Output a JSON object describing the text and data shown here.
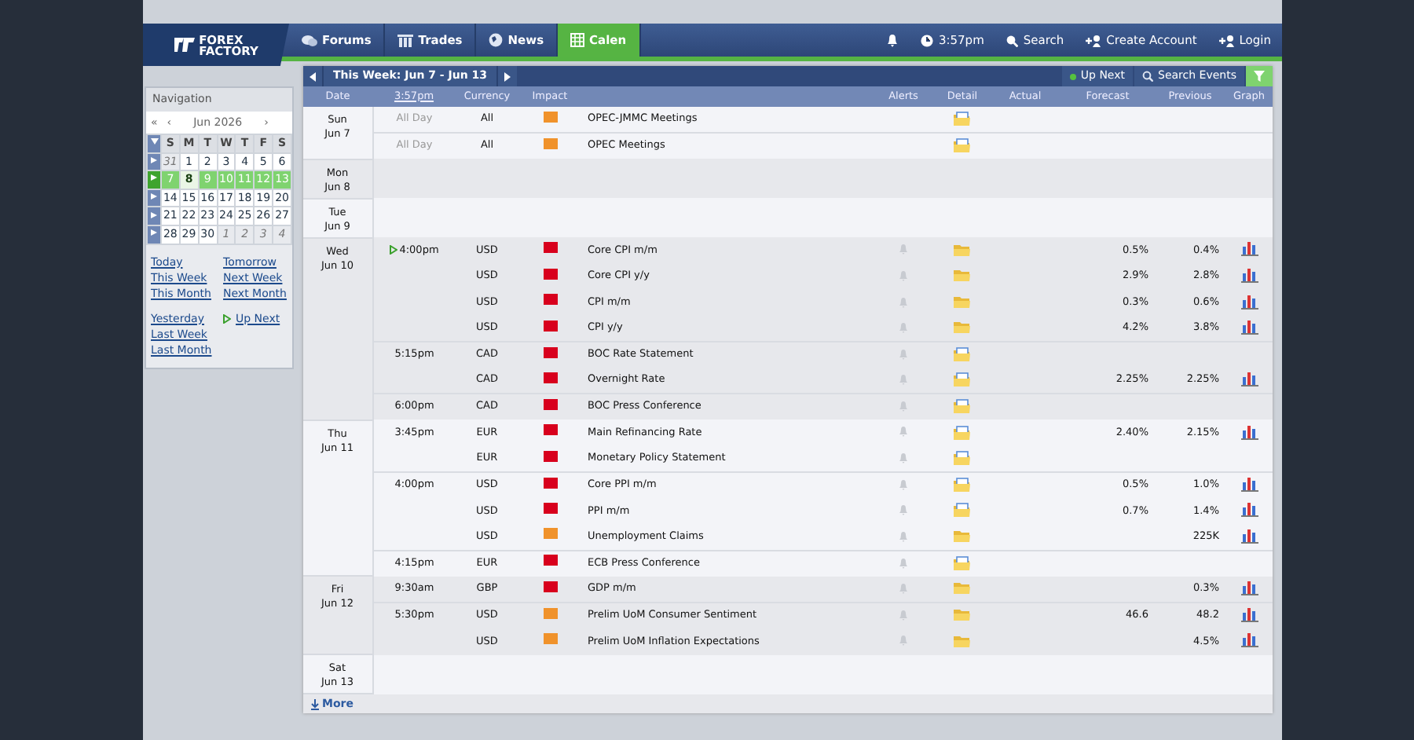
{
  "header": {
    "logo": [
      "FOREX",
      "FACTORY"
    ],
    "tabs": [
      {
        "kind": "chat",
        "label": "Forums",
        "selected": false
      },
      {
        "kind": "trades",
        "label": "Trades",
        "selected": false
      },
      {
        "kind": "globe",
        "label": "News",
        "selected": false
      },
      {
        "kind": "calendar",
        "label": "Calen",
        "selected": true
      }
    ],
    "time": "3:57pm",
    "links": [
      {
        "kind": "search",
        "label": "Search"
      },
      {
        "kind": "account",
        "label": "Create Account"
      },
      {
        "kind": "account",
        "label": "Login"
      }
    ]
  },
  "sidebar": {
    "title": "Navigation",
    "nav_left": [
      "«",
      "‹"
    ],
    "month": "Jun 2026",
    "nav_right": "›",
    "weekdays": [
      "S",
      "M",
      "T",
      "W",
      "T",
      "F",
      "S"
    ],
    "weeks": [
      {
        "selected": false,
        "days": [
          {
            "d": "31",
            "other": true,
            "today": false
          },
          {
            "d": "1",
            "other": false,
            "today": false
          },
          {
            "d": "2",
            "other": false,
            "today": false
          },
          {
            "d": "3",
            "other": false,
            "today": false
          },
          {
            "d": "4",
            "other": false,
            "today": false
          },
          {
            "d": "5",
            "other": false,
            "today": false
          },
          {
            "d": "6",
            "other": false,
            "today": false
          }
        ]
      },
      {
        "selected": true,
        "days": [
          {
            "d": "7",
            "other": false,
            "today": false
          },
          {
            "d": "8",
            "other": false,
            "today": true
          },
          {
            "d": "9",
            "other": false,
            "today": false
          },
          {
            "d": "10",
            "other": false,
            "today": false
          },
          {
            "d": "11",
            "other": false,
            "today": false
          },
          {
            "d": "12",
            "other": false,
            "today": false
          },
          {
            "d": "13",
            "other": false,
            "today": false
          }
        ]
      },
      {
        "selected": false,
        "days": [
          {
            "d": "14",
            "other": false,
            "today": false
          },
          {
            "d": "15",
            "other": false,
            "today": false
          },
          {
            "d": "16",
            "other": false,
            "today": false
          },
          {
            "d": "17",
            "other": false,
            "today": false
          },
          {
            "d": "18",
            "other": false,
            "today": false
          },
          {
            "d": "19",
            "other": false,
            "today": false
          },
          {
            "d": "20",
            "other": false,
            "today": false
          }
        ]
      },
      {
        "selected": false,
        "days": [
          {
            "d": "21",
            "other": false,
            "today": false
          },
          {
            "d": "22",
            "other": false,
            "today": false
          },
          {
            "d": "23",
            "other": false,
            "today": false
          },
          {
            "d": "24",
            "other": false,
            "today": false
          },
          {
            "d": "25",
            "other": false,
            "today": false
          },
          {
            "d": "26",
            "other": false,
            "today": false
          },
          {
            "d": "27",
            "other": false,
            "today": false
          }
        ]
      },
      {
        "selected": false,
        "days": [
          {
            "d": "28",
            "other": false,
            "today": false
          },
          {
            "d": "29",
            "other": false,
            "today": false
          },
          {
            "d": "30",
            "other": false,
            "today": false
          },
          {
            "d": "1",
            "other": true,
            "today": false
          },
          {
            "d": "2",
            "other": true,
            "today": false
          },
          {
            "d": "3",
            "other": true,
            "today": false
          },
          {
            "d": "4",
            "other": true,
            "today": false
          }
        ]
      }
    ],
    "link_groups": [
      {
        "left": [
          {
            "label": "Today"
          },
          {
            "label": "This Week"
          },
          {
            "label": "This Month"
          }
        ],
        "right": [
          {
            "label": "Tomorrow"
          },
          {
            "label": "Next Week"
          },
          {
            "label": "Next Month"
          }
        ]
      },
      {
        "left": [
          {
            "label": "Yesterday"
          },
          {
            "label": "Last Week"
          },
          {
            "label": "Last Month"
          }
        ],
        "right": [
          {
            "label": "Up Next",
            "up_next": true
          }
        ]
      }
    ]
  },
  "calendar": {
    "week_label": "This Week: Jun 7 - Jun 13",
    "up_next": "Up Next",
    "search": "Search Events",
    "columns": [
      "Date",
      "3:57pm",
      "Currency",
      "Impact",
      null,
      "Alerts",
      "Detail",
      "Actual",
      "Forecast",
      "Previous",
      "Graph"
    ],
    "days": [
      {
        "day": "Sun",
        "date": "Jun 7",
        "events": [
          {
            "time": "All Day",
            "all_day": true,
            "currency": "All",
            "color": "#f0922b",
            "title": "OPEC-JMMC Meetings",
            "alert": false,
            "has_note": true,
            "graph": false
          },
          {
            "time": "All Day",
            "all_day": true,
            "currency": "All",
            "color": "#f0922b",
            "title": "OPEC Meetings",
            "alert": false,
            "has_note": true,
            "graph": false
          }
        ]
      },
      {
        "day": "Mon",
        "date": "Jun 8"
      },
      {
        "day": "Tue",
        "date": "Jun 9"
      },
      {
        "day": "Wed",
        "date": "Jun 10",
        "events": [
          {
            "time": "4:00pm",
            "up_next": true,
            "currency": "USD",
            "color": "#d8001d",
            "title": "Core CPI m/m",
            "alert": true,
            "has_note": false,
            "forecast": "0.5%",
            "previous": "0.4%",
            "graph": true
          },
          {
            "currency": "USD",
            "color": "#d8001d",
            "title": "Core CPI y/y",
            "alert": true,
            "has_note": false,
            "forecast": "2.9%",
            "previous": "2.8%",
            "graph": true
          },
          {
            "currency": "USD",
            "color": "#d8001d",
            "title": "CPI m/m",
            "alert": true,
            "has_note": false,
            "forecast": "0.3%",
            "previous": "0.6%",
            "graph": true
          },
          {
            "currency": "USD",
            "color": "#d8001d",
            "title": "CPI y/y",
            "alert": true,
            "has_note": false,
            "forecast": "4.2%",
            "previous": "3.8%",
            "graph": true
          },
          {
            "time": "5:15pm",
            "currency": "CAD",
            "color": "#d8001d",
            "title": "BOC Rate Statement",
            "alert": true,
            "has_note": true,
            "graph": false
          },
          {
            "currency": "CAD",
            "color": "#d8001d",
            "title": "Overnight Rate",
            "alert": true,
            "has_note": true,
            "forecast": "2.25%",
            "previous": "2.25%",
            "graph": true
          },
          {
            "time": "6:00pm",
            "currency": "CAD",
            "color": "#d8001d",
            "title": "BOC Press Conference",
            "alert": true,
            "has_note": true,
            "graph": false
          }
        ]
      },
      {
        "day": "Thu",
        "date": "Jun 11",
        "events": [
          {
            "time": "3:45pm",
            "currency": "EUR",
            "color": "#d8001d",
            "title": "Main Refinancing Rate",
            "alert": true,
            "has_note": true,
            "forecast": "2.40%",
            "previous": "2.15%",
            "graph": true
          },
          {
            "currency": "EUR",
            "color": "#d8001d",
            "title": "Monetary Policy Statement",
            "alert": true,
            "has_note": true,
            "graph": false
          },
          {
            "time": "4:00pm",
            "currency": "USD",
            "color": "#d8001d",
            "title": "Core PPI m/m",
            "alert": true,
            "has_note": true,
            "forecast": "0.5%",
            "previous": "1.0%",
            "graph": true
          },
          {
            "currency": "USD",
            "color": "#d8001d",
            "title": "PPI m/m",
            "alert": true,
            "has_note": true,
            "forecast": "0.7%",
            "previous": "1.4%",
            "graph": true
          },
          {
            "currency": "USD",
            "color": "#f0922b",
            "title": "Unemployment Claims",
            "alert": true,
            "has_note": false,
            "previous": "225K",
            "graph": true
          },
          {
            "time": "4:15pm",
            "currency": "EUR",
            "color": "#d8001d",
            "title": "ECB Press Conference",
            "alert": true,
            "has_note": true,
            "graph": false
          }
        ]
      },
      {
        "day": "Fri",
        "date": "Jun 12",
        "events": [
          {
            "time": "9:30am",
            "currency": "GBP",
            "color": "#d8001d",
            "title": "GDP m/m",
            "alert": true,
            "has_note": false,
            "previous": "0.3%",
            "graph": true
          },
          {
            "time": "5:30pm",
            "currency": "USD",
            "color": "#f0922b",
            "title": "Prelim UoM Consumer Sentiment",
            "alert": true,
            "has_note": false,
            "forecast": "46.6",
            "previous": "48.2",
            "graph": true
          },
          {
            "currency": "USD",
            "color": "#f0922b",
            "title": "Prelim UoM Inflation Expectations",
            "alert": true,
            "has_note": false,
            "previous": "4.5%",
            "graph": true
          }
        ]
      },
      {
        "day": "Sat",
        "date": "Jun 13"
      }
    ],
    "more": "More"
  }
}
